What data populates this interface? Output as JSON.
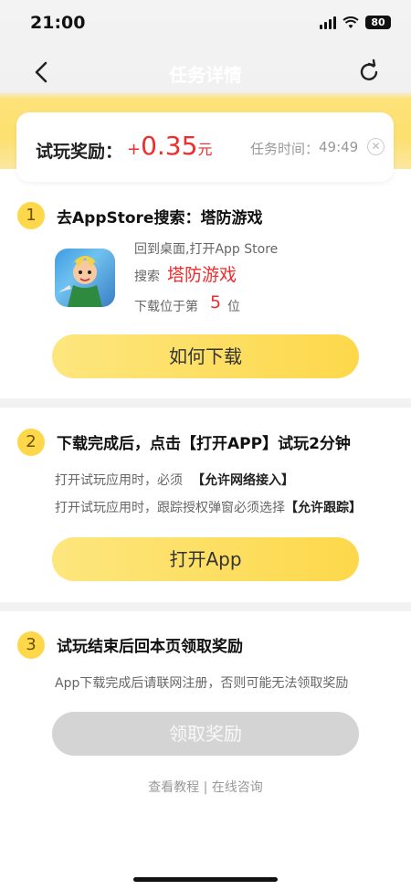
{
  "status": {
    "time": "21:00",
    "battery": "80"
  },
  "nav": {
    "title": "任务详情"
  },
  "reward": {
    "label": "试玩奖励：",
    "plus": "+",
    "amount": "0.35",
    "unit": "元",
    "time_label": "任务时间：",
    "time_value": "49:49"
  },
  "step1": {
    "number": "1",
    "title": "去AppStore搜索：塔防游戏",
    "line1": "回到桌面,打开App Store",
    "search_prefix": "搜索",
    "keyword": "塔防游戏",
    "rank_prefix": "下载位于第",
    "rank": "5",
    "rank_suffix": "位",
    "button": "如何下载"
  },
  "step2": {
    "number": "2",
    "title": "下载完成后，点击【打开APP】试玩2分钟",
    "line1_prefix": "打开试玩应用时，必须",
    "line1_bold": "【允许网络接入】",
    "line2_prefix": "打开试玩应用时，跟踪授权弹窗必须选择",
    "line2_bold": "【允许跟踪】",
    "button": "打开App"
  },
  "step3": {
    "number": "3",
    "title": "试玩结束后回本页领取奖励",
    "line1": "App下载完成后请联网注册，否则可能无法领取奖励",
    "button": "领取奖励"
  },
  "footer": {
    "tutorial": "查看教程",
    "separator": "|",
    "consult": "在线咨询"
  },
  "colors": {
    "accent": "#fdd84a",
    "price": "#f22b2b",
    "badge": "#ffd74a"
  }
}
